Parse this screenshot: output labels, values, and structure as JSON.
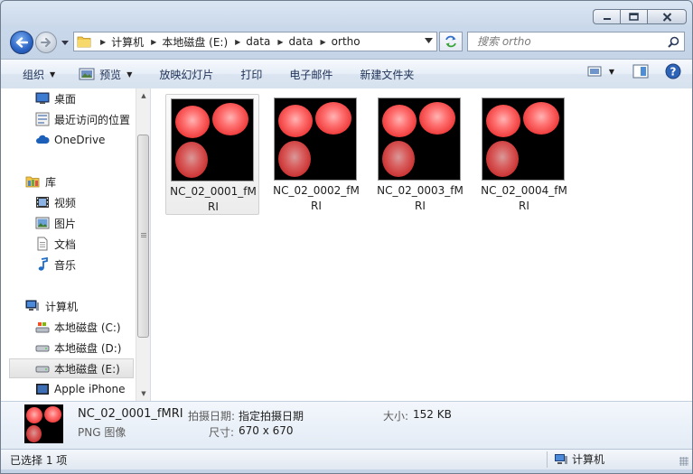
{
  "window": {
    "controls": {
      "minimize_icon": "minimize-icon",
      "maximize_icon": "maximize-icon",
      "close_icon": "close-icon"
    }
  },
  "navigation": {
    "back_icon": "back-arrow-icon",
    "forward_icon": "forward-arrow-icon",
    "breadcrumbs": [
      "计算机",
      "本地磁盘 (E:)",
      "data",
      "data",
      "ortho"
    ],
    "search_placeholder": "搜索 ortho"
  },
  "commands": {
    "organize": "组织",
    "preview": "预览",
    "slideshow": "放映幻灯片",
    "print": "打印",
    "email": "电子邮件",
    "new_folder": "新建文件夹"
  },
  "sidebar": {
    "favorites": [
      {
        "label": "桌面",
        "icon": "desktop-icon"
      },
      {
        "label": "最近访问的位置",
        "icon": "recent-places-icon"
      },
      {
        "label": "OneDrive",
        "icon": "cloud-icon"
      }
    ],
    "library": {
      "label": "库",
      "icon": "library-icon"
    },
    "libraries": [
      {
        "label": "视频",
        "icon": "video-icon"
      },
      {
        "label": "图片",
        "icon": "pictures-icon"
      },
      {
        "label": "文档",
        "icon": "documents-icon"
      },
      {
        "label": "音乐",
        "icon": "music-icon"
      }
    ],
    "computer": {
      "label": "计算机",
      "icon": "computer-icon"
    },
    "drives": [
      {
        "label": "本地磁盘 (C:)",
        "icon": "system-drive-icon"
      },
      {
        "label": "本地磁盘 (D:)",
        "icon": "drive-icon"
      },
      {
        "label": "本地磁盘 (E:)",
        "icon": "drive-icon"
      },
      {
        "label": "Apple iPhone",
        "icon": "phone-icon"
      }
    ],
    "selected": "本地磁盘 (E:)"
  },
  "files": [
    {
      "name": "NC_02_0001_fMRI",
      "selected": true
    },
    {
      "name": "NC_02_0002_fMRI",
      "selected": false
    },
    {
      "name": "NC_02_0003_fMRI",
      "selected": false
    },
    {
      "name": "NC_02_0004_fMRI",
      "selected": false
    }
  ],
  "details": {
    "name": "NC_02_0001_fMRI",
    "type": "PNG 图像",
    "date_label": "拍摄日期:",
    "date_value": "指定拍摄日期",
    "size_label": "大小:",
    "size_value": "152 KB",
    "dims_label": "尺寸:",
    "dims_value": "670 x 670"
  },
  "status": {
    "selection": "已选择 1 项",
    "location": "计算机"
  },
  "colors": {
    "accent": "#2a63c4",
    "brain": "#f03e3e",
    "selection_bg": "#e2e2e2"
  }
}
